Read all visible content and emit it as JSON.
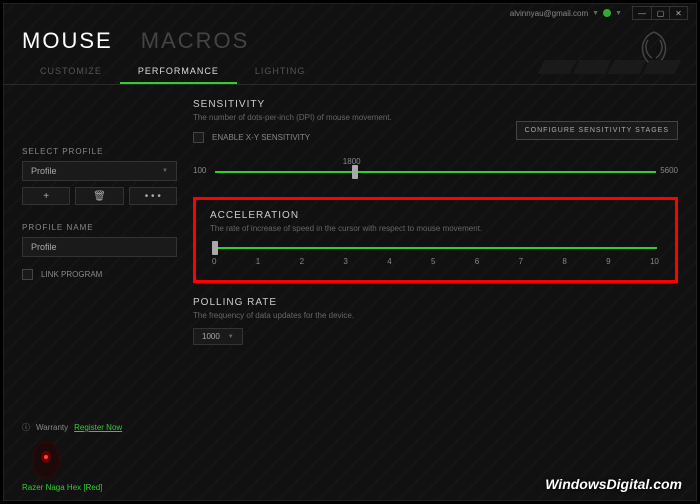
{
  "topbar": {
    "email": "alvinnyau@gmail.com"
  },
  "header": {
    "tab_mouse": "MOUSE",
    "tab_macros": "MACROS"
  },
  "subtabs": {
    "customize": "CUSTOMIZE",
    "performance": "PERFORMANCE",
    "lighting": "LIGHTING"
  },
  "sidebar": {
    "select_profile_label": "SELECT PROFILE",
    "profile_value": "Profile",
    "add_btn": "+",
    "del_btn": "🗑",
    "more_btn": "• • •",
    "profile_name_label": "PROFILE NAME",
    "profile_name_value": "Profile",
    "link_program": "LINK PROGRAM"
  },
  "sensitivity": {
    "title": "SENSITIVITY",
    "desc": "The number of dots-per-inch (DPI) of mouse movement.",
    "enable_xy": "ENABLE X-Y SENSITIVITY",
    "config_btn": "CONFIGURE SENSITIVITY STAGES",
    "min": "100",
    "value": "1800",
    "max": "5600"
  },
  "acceleration": {
    "title": "ACCELERATION",
    "desc": "The rate of increase of speed in the cursor with respect to mouse movement.",
    "ticks": [
      "0",
      "1",
      "2",
      "3",
      "4",
      "5",
      "6",
      "7",
      "8",
      "9",
      "10"
    ]
  },
  "polling": {
    "title": "POLLING RATE",
    "desc": "The frequency of data updates for the device.",
    "value": "1000"
  },
  "footer": {
    "warranty": "Warranty",
    "register": "Register Now",
    "device": "Razer Naga Hex [Red]"
  },
  "watermark": "WindowsDigital.com"
}
